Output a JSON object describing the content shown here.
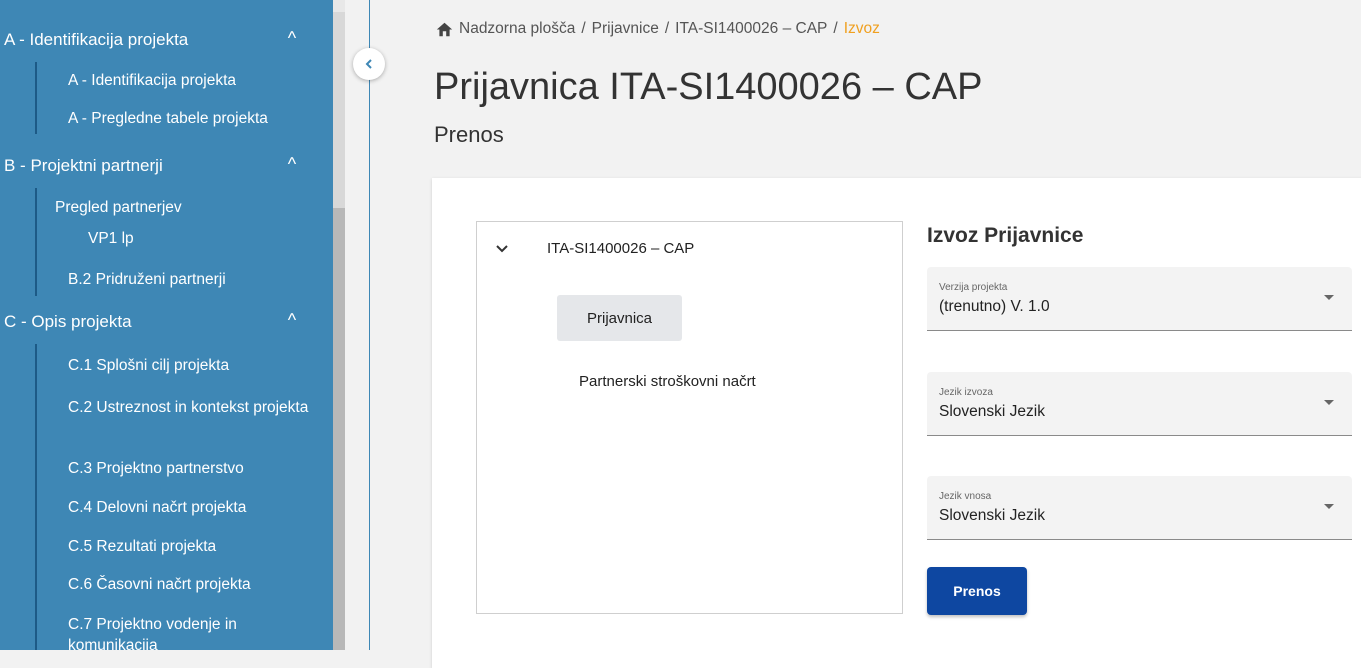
{
  "sidebar": {
    "groups": [
      {
        "label": "A - Identifikacija projekta",
        "chevron": "^"
      },
      {
        "label": "B - Projektni partnerji",
        "chevron": "^"
      },
      {
        "label": "C - Opis projekta",
        "chevron": "^"
      }
    ],
    "items": [
      "A - Identifikacija projekta",
      "A - Pregledne tabele projekta",
      "Pregled partnerjev",
      "VP1 lp",
      "B.2 Pridruženi partnerji",
      "C.1 Splošni cilj projekta",
      "C.2 Ustreznost in kontekst projekta",
      "C.3 Projektno partnerstvo",
      "C.4 Delovni načrt projekta",
      "C.5 Rezultati projekta",
      "C.6 Časovni načrt projekta",
      "C.7 Projektno vodenje in komunikacija"
    ]
  },
  "breadcrumb": {
    "home": "Nadzorna plošča",
    "sep": "/",
    "level2": "Prijavnice",
    "level3": "ITA-SI1400026 – CAP",
    "current": "Izvoz"
  },
  "page": {
    "title": "Prijavnica ITA-SI1400026 – CAP",
    "subtitle": "Prenos"
  },
  "tree": {
    "root": "ITA-SI1400026 – CAP",
    "selected": "Prijavnica",
    "node": "Partnerski stroškovni načrt"
  },
  "export": {
    "title": "Izvoz Prijavnice",
    "fields": [
      {
        "label": "Verzija projekta",
        "value": "(trenutno) V. 1.0"
      },
      {
        "label": "Jezik izvoza",
        "value": "Slovenski Jezik"
      },
      {
        "label": "Jezik vnosa",
        "value": "Slovenski Jezik"
      }
    ],
    "button": "Prenos"
  },
  "colors": {
    "sidebar": "#3e87b5",
    "button": "#0e47a1",
    "breadcrumb_current": "#f0a020"
  },
  "icons": {
    "home": "home-icon",
    "collapse": "chevron-left-icon",
    "expand": "chevron-down-icon",
    "dropdown": "dropdown-arrow-icon"
  }
}
